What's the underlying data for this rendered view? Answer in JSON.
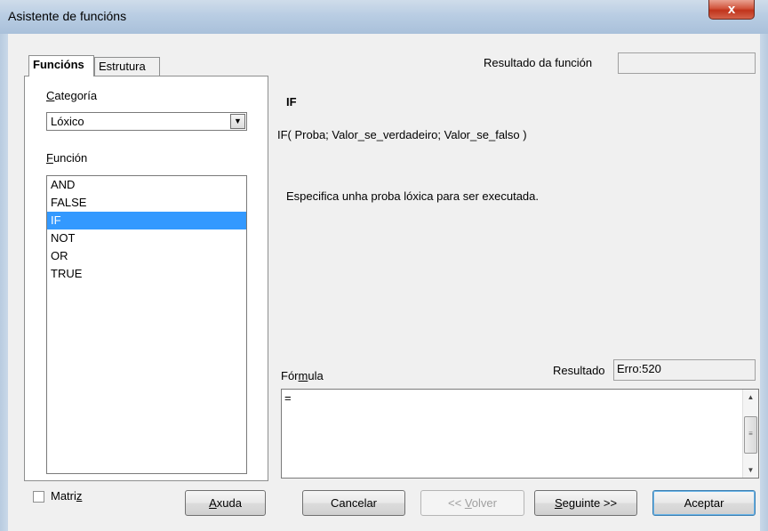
{
  "window": {
    "title": "Asistente de funcións",
    "close_glyph": "x"
  },
  "tabs": [
    {
      "label": "Funcións",
      "active": true
    },
    {
      "label": "Estrutura",
      "active": false
    }
  ],
  "left": {
    "category_label_u": "C",
    "category_label_rest": "ategoría",
    "category_value": "Lóxico",
    "function_label_u": "F",
    "function_label_rest": "unción",
    "functions": [
      {
        "label": "AND",
        "selected": false
      },
      {
        "label": "FALSE",
        "selected": false
      },
      {
        "label": "IF",
        "selected": true
      },
      {
        "label": "NOT",
        "selected": false
      },
      {
        "label": "OR",
        "selected": false
      },
      {
        "label": "TRUE",
        "selected": false
      }
    ]
  },
  "right": {
    "function_result_label": "Resultado da función",
    "function_result_value": "",
    "function_name": "IF",
    "syntax": "IF( Proba; Valor_se_verdadeiro; Valor_se_falso )",
    "description": "Especifica unha proba lóxica para ser executada.",
    "formula_label_pre": "Fór",
    "formula_label_u": "m",
    "formula_label_post": "ula",
    "result_label": "Resultado",
    "result_value": "Erro:520",
    "formula_text": "="
  },
  "footer": {
    "array_label_pre": "Matri",
    "array_label_u": "z",
    "array_checked": false,
    "help_u": "A",
    "help_rest": "xuda",
    "cancel": "Cancelar",
    "back_pre": "<< ",
    "back_u": "V",
    "back_rest": "olver",
    "next_u": "S",
    "next_rest": "eguinte >>",
    "ok": "Aceptar"
  },
  "icons": {
    "combo_arrow": "▼",
    "scroll_up": "▲",
    "scroll_down": "▼",
    "thumb_grip": "≡"
  }
}
